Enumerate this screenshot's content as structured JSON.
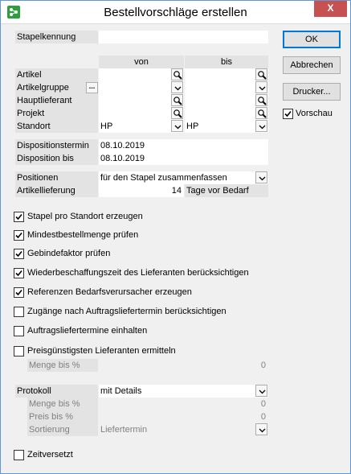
{
  "window": {
    "title": "Bestellvorschläge erstellen",
    "close_symbol": "X"
  },
  "buttons": {
    "ok": "OK",
    "cancel": "Abbrechen",
    "printer": "Drucker...",
    "preview_label": "Vorschau",
    "preview_checked": true
  },
  "batch": {
    "label": "Stapelkennung",
    "value": ""
  },
  "range": {
    "col_from": "von",
    "col_to": "bis",
    "rows": [
      {
        "label": "Artikel",
        "from": "",
        "to": ""
      },
      {
        "label": "Artikelgruppe",
        "from": "",
        "to": "",
        "has_dots": true
      },
      {
        "label": "Hauptlieferant",
        "from": "",
        "to": ""
      },
      {
        "label": "Projekt",
        "from": "",
        "to": ""
      },
      {
        "label": "Standort",
        "from": "HP",
        "to": "HP"
      }
    ]
  },
  "dates": {
    "disposition_date_label": "Dispositionstermin",
    "disposition_date": "08.10.2019",
    "disposition_until_label": "Disposition bis",
    "disposition_until": "08.10.2019"
  },
  "positions": {
    "label": "Positionen",
    "value": "für den Stapel zusammenfassen"
  },
  "delivery": {
    "label": "Artikellieferung",
    "value": "14",
    "unit": "Tage vor Bedarf"
  },
  "options": [
    {
      "label": "Stapel pro Standort erzeugen",
      "checked": true
    },
    {
      "label": "Mindestbestellmenge prüfen",
      "checked": true
    },
    {
      "label": "Gebindefaktor prüfen",
      "checked": true
    },
    {
      "label": "Wiederbeschaffungszeit des Lieferanten berücksichtigen",
      "checked": true
    },
    {
      "label": "Referenzen Bedarfsverursacher erzeugen",
      "checked": true
    },
    {
      "label": "Zugänge nach Auftragsliefertermin berücksichtigen",
      "checked": false
    },
    {
      "label": "Auftragsliefertermine einhalten",
      "checked": false
    },
    {
      "label": "Preisgünstigsten Lieferanten ermitteln",
      "checked": false
    }
  ],
  "cheapest": {
    "quantity_label": "Menge bis %",
    "quantity_value": "0"
  },
  "protocol": {
    "label": "Protokoll",
    "value": "mit Details",
    "quantity_label": "Menge bis %",
    "quantity_value": "0",
    "price_label": "Preis bis %",
    "price_value": "0",
    "sort_label": "Sortierung",
    "sort_value": "Liefertermin"
  },
  "staggered": {
    "label": "Zeitversetzt",
    "checked": false
  },
  "icons": {
    "app": "app-icon",
    "search": "magnifier-icon",
    "dropdown": "chevron-down-icon",
    "check": "checkmark-icon"
  }
}
